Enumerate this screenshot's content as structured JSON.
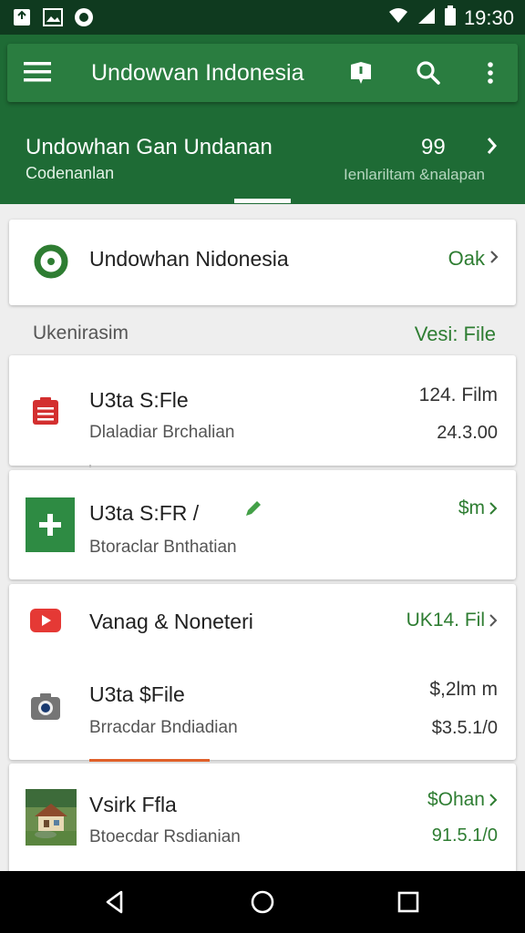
{
  "status_bar": {
    "time": "19:30",
    "icons": [
      "notification-icon",
      "image-icon",
      "circle-app-icon",
      "wifi-icon",
      "signal-icon",
      "battery-icon"
    ]
  },
  "app_bar": {
    "title": "Undowvan Indonesia",
    "actions": [
      "map-pin-icon",
      "search-icon",
      "overflow-menu-icon"
    ]
  },
  "summary": {
    "title": "Undowhan Gan Undanan",
    "subtitle": "Codenanlan",
    "count": "99",
    "right_subtitle": "Ienlariltam &nalapan"
  },
  "account": {
    "name": "Undowhan Nidonesia",
    "link_label": "Oak"
  },
  "section": {
    "label": "Ukenirasim",
    "action": "Vesi: File"
  },
  "items": [
    {
      "title": "U3ta S:Fle",
      "subtitle": "Dlaladiar Brchalian",
      "amount": "124. Film",
      "date": "24.3.00",
      "icon": "document-icon"
    },
    {
      "title": "U3ta S:FR /",
      "subtitle": "Btoraclar Bnthatian",
      "amount": "$m",
      "date": "",
      "icon": "add-box-icon"
    },
    {
      "title": "Vanag & Noneteri",
      "subtitle": "",
      "amount": "UK14. Fil",
      "date": "",
      "icon": "play-video-icon"
    },
    {
      "title": "U3ta $File",
      "subtitle": "Brracdar Bndiadian",
      "amount": "$,2lm m",
      "date": "$3.5.1/0",
      "icon": "camera-icon"
    },
    {
      "title": "Vsirk Ffla",
      "subtitle": "Btoecdar Rsdianian",
      "amount": "$Ohan",
      "date": "91.5.1/0",
      "icon": "house-photo-thumbnail"
    }
  ],
  "colors": {
    "primary": "#1e6b35",
    "accent_green": "#2e7d32",
    "status_bar": "#0f3a1f"
  }
}
